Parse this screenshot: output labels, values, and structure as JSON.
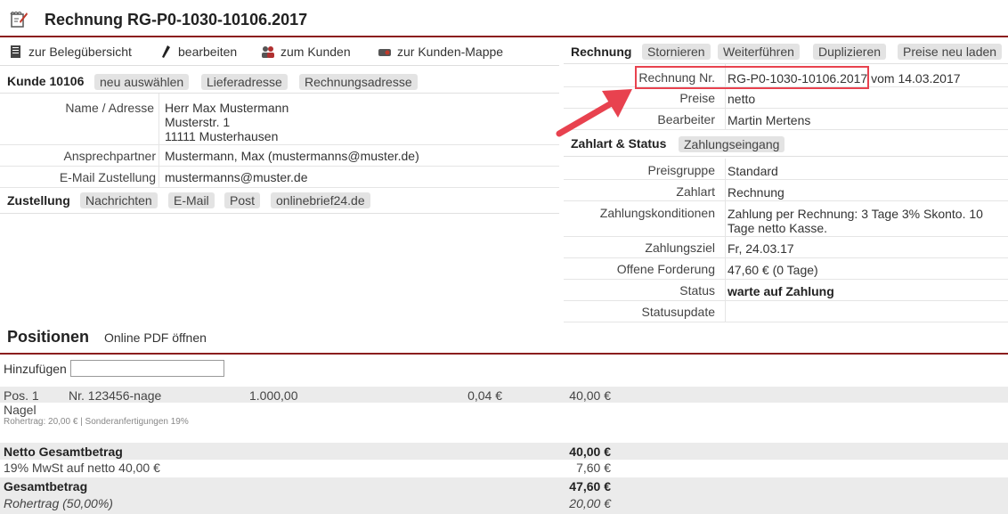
{
  "header": {
    "title": "Rechnung RG-P0-1030-10106.2017",
    "icon": "invoice-icon"
  },
  "toolbar": {
    "overview": "zur Belegübersicht",
    "edit": "bearbeiten",
    "customer": "zum Kunden",
    "folder": "zur Kunden-Mappe"
  },
  "customer": {
    "title": "Kunde 10106",
    "buttons": [
      "neu auswählen",
      "Lieferadresse",
      "Rechnungsadresse"
    ],
    "name_label": "Name / Adresse",
    "name_lines": [
      "Herr Max Mustermann",
      "Musterstr. 1",
      "11111 Musterhausen"
    ],
    "contact_label": "Ansprechpartner",
    "contact_value": "Mustermann, Max (mustermanns@muster.de)",
    "email_label": "E-Mail Zustellung",
    "email_value": "mustermanns@muster.de"
  },
  "delivery": {
    "title": "Zustellung",
    "buttons": [
      "Nachrichten",
      "E-Mail",
      "Post",
      "onlinebrief24.de"
    ]
  },
  "invoice": {
    "title": "Rechnung",
    "buttons": [
      "Stornieren",
      "Weiterführen",
      "Duplizieren",
      "Preise neu laden"
    ],
    "number_label": "Rechnung Nr.",
    "number_value": "RG-P0-1030-10106.2017",
    "date_suffix": "vom 14.03.2017",
    "prices_label": "Preise",
    "prices_value": "netto",
    "editor_label": "Bearbeiter",
    "editor_value": "Martin Mertens"
  },
  "payment": {
    "title": "Zahlart & Status",
    "button": "Zahlungseingang",
    "rows": [
      {
        "label": "Preisgruppe",
        "value": "Standard"
      },
      {
        "label": "Zahlart",
        "value": "Rechnung"
      },
      {
        "label": "Zahlungskonditionen",
        "value": "Zahlung per Rechnung: 3 Tage 3% Skonto. 10 Tage netto Kasse."
      },
      {
        "label": "Zahlungsziel",
        "value": "Fr, 24.03.17"
      },
      {
        "label": "Offene Forderung",
        "value": "47,60 € (0 Tage)"
      },
      {
        "label": "Status",
        "value": "warte auf Zahlung"
      },
      {
        "label": "Statusupdate",
        "value": ""
      }
    ]
  },
  "positions": {
    "title": "Positionen",
    "pdf_link": "Online PDF öffnen",
    "add_label": "Hinzufügen",
    "add_value": "",
    "item": {
      "pos": "Pos. 1",
      "number": "Nr. 123456-nage",
      "quantity": "1.000,00",
      "unit_price": "0,04 €",
      "total": "40,00 €",
      "name": "Nagel",
      "note": "Rohertrag: 20,00 € | Sonderanfertigungen 19%"
    },
    "totals": [
      {
        "label": "Netto Gesamtbetrag",
        "value": "40,00 €",
        "style": "bold"
      },
      {
        "label": "19% MwSt auf netto 40,00 €",
        "value": "7,60 €",
        "style": "normal"
      },
      {
        "label": "Gesamtbetrag",
        "value": "47,60 €",
        "style": "bold"
      },
      {
        "label": "Rohertrag (50,00%)",
        "value": "20,00 €",
        "style": "italic"
      }
    ]
  }
}
